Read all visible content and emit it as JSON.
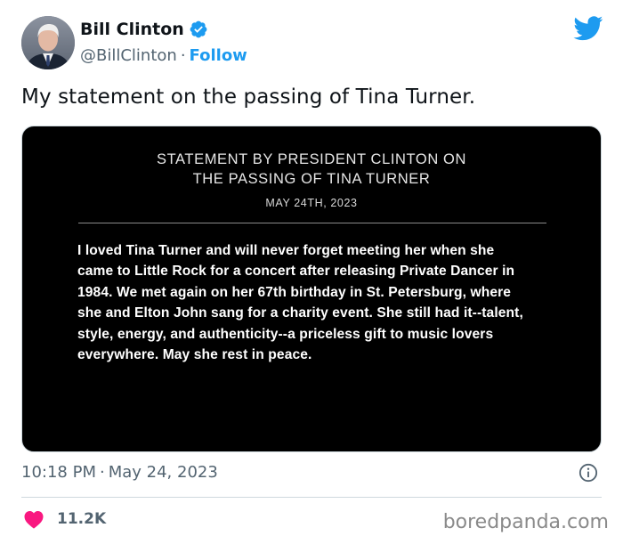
{
  "author": {
    "display_name": "Bill Clinton",
    "handle": "@BillClinton",
    "separator": "·",
    "follow_label": "Follow",
    "verified_color": "#1d9bf0"
  },
  "tweet": {
    "text": "My statement on the passing of Tina Turner."
  },
  "statement_image": {
    "title_line1": "STATEMENT BY PRESIDENT CLINTON ON",
    "title_line2": "THE PASSING OF TINA TURNER",
    "date": "MAY 24TH, 2023",
    "body_lines": [
      "I loved Tina Turner and will never forget meeting her when she",
      "came to Little Rock for a concert after releasing Private Dancer in",
      "1984. We met again on her 67th birthday in St. Petersburg, where",
      "she and Elton John sang for a charity event. She still had it--talent,",
      "style, energy, and authenticity--a priceless gift to music lovers",
      "everywhere. May she rest in peace."
    ]
  },
  "meta": {
    "time": "10:18 PM",
    "separator": "·",
    "date": "May 24, 2023"
  },
  "engagement": {
    "likes": "11.2K",
    "heart_color": "#f91880"
  },
  "watermark": "boredpanda.com",
  "icons": {
    "brand": "twitter-bird-icon",
    "verified": "verified-badge-icon",
    "like": "heart-icon",
    "info": "info-icon"
  }
}
